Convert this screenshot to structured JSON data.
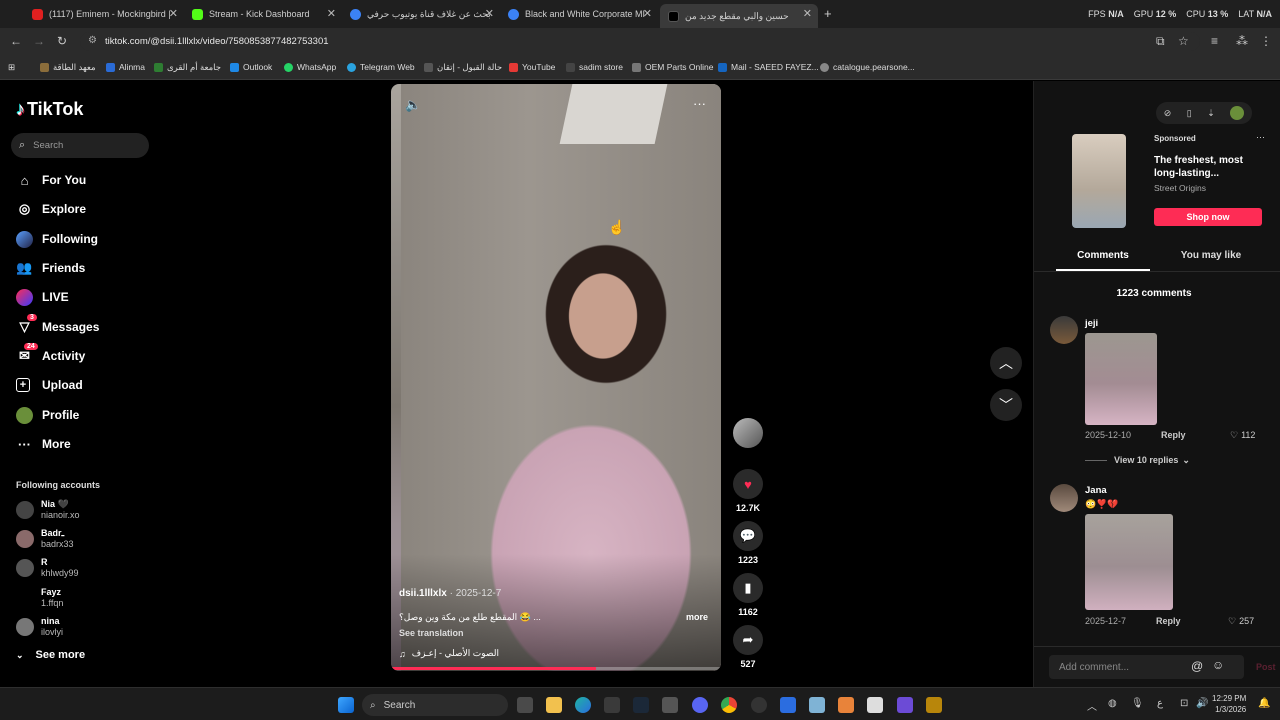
{
  "browser": {
    "tabs": [
      {
        "title": "(1117) Eminem - Mockingbird |",
        "color": "#e02020"
      },
      {
        "title": "Stream - Kick Dashboard",
        "color": "#53fc18"
      },
      {
        "title": "بحث عن غلاف قناة يوتيوب حرفي",
        "color": "#3b82f6"
      },
      {
        "title": "Black and White Corporate MI",
        "color": "#3b82f6"
      },
      {
        "title": "حسين والبي مقطع جديد من",
        "color": "#111111"
      }
    ],
    "new_tab": "+",
    "url": "tiktok.com/@dsii.1lllxlx/video/7580853877482753301",
    "stats": {
      "fps_label": "FPS",
      "fps": "N/A",
      "gpu_label": "GPU",
      "gpu": "12 %",
      "cpu_label": "CPU",
      "cpu": "13 %",
      "lat_label": "LAT",
      "lat": "N/A"
    },
    "bookmarks": [
      {
        "label": "معهد الطاقة",
        "color": "#8b6d3b"
      },
      {
        "label": "Alinma",
        "color": "#2a6bd6"
      },
      {
        "label": "جامعة أم القرى",
        "color": "#2e7d32"
      },
      {
        "label": "Outlook",
        "color": "#1e88e5"
      },
      {
        "label": "WhatsApp",
        "color": "#25d366"
      },
      {
        "label": "Telegram Web",
        "color": "#2aa3e0"
      },
      {
        "label": "حالة القبول - إتقان",
        "color": "#555555"
      },
      {
        "label": "YouTube",
        "color": "#e53935"
      },
      {
        "label": "sadim store",
        "color": "#444444"
      },
      {
        "label": "OEM Parts Online",
        "color": "#777777"
      },
      {
        "label": "Mail - SAEED FAYEZ...",
        "color": "#1565c0"
      },
      {
        "label": "catalogue.pearsone...",
        "color": "#888888"
      }
    ]
  },
  "tiktok": {
    "logo": "TikTok",
    "search_placeholder": "Search",
    "nav": [
      {
        "label": "For You",
        "icon": "home-icon"
      },
      {
        "label": "Explore",
        "icon": "compass-icon"
      },
      {
        "label": "Following",
        "icon": "following-icon"
      },
      {
        "label": "Friends",
        "icon": "friends-icon"
      },
      {
        "label": "LIVE",
        "icon": "live-icon"
      },
      {
        "label": "Messages",
        "icon": "messages-icon",
        "badge": "3"
      },
      {
        "label": "Activity",
        "icon": "activity-icon",
        "badge": "24"
      },
      {
        "label": "Upload",
        "icon": "upload-icon"
      },
      {
        "label": "Profile",
        "icon": "profile-icon"
      },
      {
        "label": "More",
        "icon": "more-icon"
      }
    ],
    "following_title": "Following accounts",
    "following": [
      {
        "name": "Nia 🖤",
        "user": "nianoir.xo"
      },
      {
        "name": "Badrـ",
        "user": "badrx33"
      },
      {
        "name": "R",
        "user": "khlwdy99"
      },
      {
        "name": "Fayz",
        "user": "1.ffqn"
      },
      {
        "name": "nina",
        "user": "ilovlyi"
      }
    ],
    "see_more": "See more",
    "video": {
      "author": "dsii.1lllxlx",
      "date": "· 2025-12-7",
      "caption": "المقطع طلع من مكة وين وصل؟ 😂 ...",
      "more": "more",
      "see_translation": "See translation",
      "sound": "الصوت الأصلي - إعـزف",
      "progress": 0.62
    },
    "actions": {
      "likes": "12.7K",
      "comments": "1223",
      "saves": "1162",
      "shares": "527"
    },
    "ad": {
      "sponsored": "Sponsored",
      "title": "The freshest, most long-lasting...",
      "brand": "Street Origins",
      "cta": "Shop now"
    },
    "tabs": {
      "comments": "Comments",
      "you_may_like": "You may like"
    },
    "comment_count": "1223 comments",
    "comments": [
      {
        "user": "jeji",
        "emoji": "",
        "date": "2025-12-10",
        "reply": "Reply",
        "likes": "112",
        "replies": "View 10 replies"
      },
      {
        "user": "Jana",
        "emoji": "😳❣️💔",
        "date": "2025-12-7",
        "reply": "Reply",
        "likes": "257"
      }
    ],
    "add_comment_placeholder": "Add comment...",
    "post": "Post"
  },
  "taskbar": {
    "search_placeholder": "Search",
    "time": "12:29 PM",
    "date": "1/3/2026",
    "lang": "ع"
  }
}
